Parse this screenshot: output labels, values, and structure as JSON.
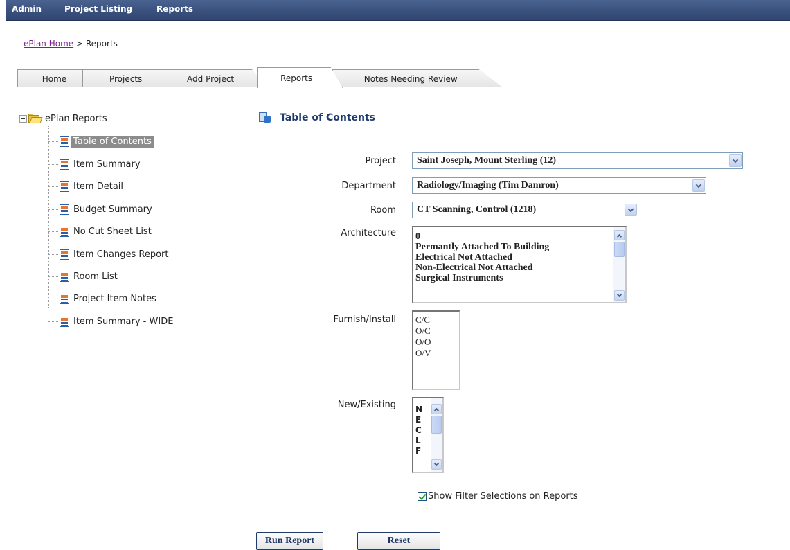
{
  "menu": {
    "items": [
      {
        "label": "Admin"
      },
      {
        "label": "Project Listing"
      },
      {
        "label": "Reports"
      }
    ]
  },
  "breadcrumb": {
    "home_link": "ePlan Home",
    "separator_and_current": "> Reports"
  },
  "tabs": [
    {
      "label": "Home",
      "active": false
    },
    {
      "label": "Projects",
      "active": false
    },
    {
      "label": "Add Project",
      "active": false
    },
    {
      "label": "Reports",
      "active": true
    },
    {
      "label": "Notes Needing Review",
      "active": false
    }
  ],
  "tree": {
    "root_label": "ePlan Reports",
    "items": [
      {
        "label": "Table of Contents",
        "selected": true
      },
      {
        "label": "Item Summary"
      },
      {
        "label": "Item Detail"
      },
      {
        "label": "Budget Summary"
      },
      {
        "label": "No Cut Sheet List"
      },
      {
        "label": "Item Changes Report"
      },
      {
        "label": "Room List"
      },
      {
        "label": "Project Item Notes"
      },
      {
        "label": "Item Summary - WIDE"
      }
    ]
  },
  "form": {
    "title": "Table of Contents",
    "project": {
      "label": "Project",
      "value": "Saint Joseph, Mount Sterling (12)"
    },
    "department": {
      "label": "Department",
      "value": "Radiology/Imaging (Tim Damron)"
    },
    "room": {
      "label": "Room",
      "value": "CT Scanning, Control (1218)"
    },
    "architecture": {
      "label": "Architecture",
      "options": [
        "0",
        "Permantly Attached To Building",
        "Electrical Not Attached",
        "Non-Electrical Not Attached",
        "Surgical Instruments"
      ]
    },
    "furnish_install": {
      "label": "Furnish/Install",
      "options": [
        "C/C",
        "O/C",
        "O/O",
        "O/V"
      ]
    },
    "new_existing": {
      "label": "New/Existing",
      "options": [
        "N",
        "E",
        "C",
        "L",
        "F"
      ]
    },
    "show_filters": {
      "label": "Show Filter Selections on Reports",
      "checked": true
    },
    "run_button": "Run Report",
    "reset_button": "Reset"
  },
  "icons": {
    "report": "report-document-icon",
    "folder": "open-folder-icon",
    "toc": "table-of-contents-icon"
  },
  "colors": {
    "menubar": "#3a517e",
    "link": "#7c1f8f",
    "title": "#1f3b6e",
    "selected_bg": "#8c8c8c"
  }
}
